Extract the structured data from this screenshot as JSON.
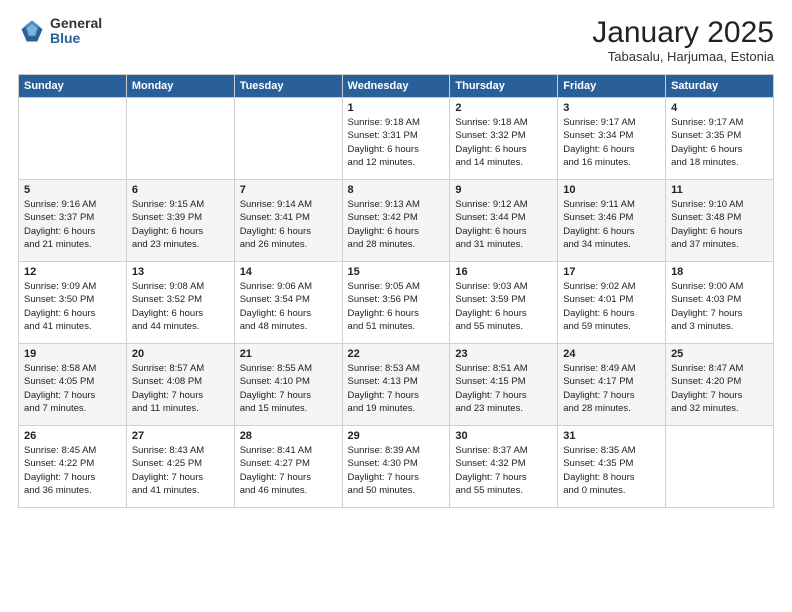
{
  "logo": {
    "general": "General",
    "blue": "Blue"
  },
  "header": {
    "title": "January 2025",
    "subtitle": "Tabasalu, Harjumaa, Estonia"
  },
  "weekdays": [
    "Sunday",
    "Monday",
    "Tuesday",
    "Wednesday",
    "Thursday",
    "Friday",
    "Saturday"
  ],
  "weeks": [
    [
      {
        "day": "",
        "info": ""
      },
      {
        "day": "",
        "info": ""
      },
      {
        "day": "",
        "info": ""
      },
      {
        "day": "1",
        "info": "Sunrise: 9:18 AM\nSunset: 3:31 PM\nDaylight: 6 hours\nand 12 minutes."
      },
      {
        "day": "2",
        "info": "Sunrise: 9:18 AM\nSunset: 3:32 PM\nDaylight: 6 hours\nand 14 minutes."
      },
      {
        "day": "3",
        "info": "Sunrise: 9:17 AM\nSunset: 3:34 PM\nDaylight: 6 hours\nand 16 minutes."
      },
      {
        "day": "4",
        "info": "Sunrise: 9:17 AM\nSunset: 3:35 PM\nDaylight: 6 hours\nand 18 minutes."
      }
    ],
    [
      {
        "day": "5",
        "info": "Sunrise: 9:16 AM\nSunset: 3:37 PM\nDaylight: 6 hours\nand 21 minutes."
      },
      {
        "day": "6",
        "info": "Sunrise: 9:15 AM\nSunset: 3:39 PM\nDaylight: 6 hours\nand 23 minutes."
      },
      {
        "day": "7",
        "info": "Sunrise: 9:14 AM\nSunset: 3:41 PM\nDaylight: 6 hours\nand 26 minutes."
      },
      {
        "day": "8",
        "info": "Sunrise: 9:13 AM\nSunset: 3:42 PM\nDaylight: 6 hours\nand 28 minutes."
      },
      {
        "day": "9",
        "info": "Sunrise: 9:12 AM\nSunset: 3:44 PM\nDaylight: 6 hours\nand 31 minutes."
      },
      {
        "day": "10",
        "info": "Sunrise: 9:11 AM\nSunset: 3:46 PM\nDaylight: 6 hours\nand 34 minutes."
      },
      {
        "day": "11",
        "info": "Sunrise: 9:10 AM\nSunset: 3:48 PM\nDaylight: 6 hours\nand 37 minutes."
      }
    ],
    [
      {
        "day": "12",
        "info": "Sunrise: 9:09 AM\nSunset: 3:50 PM\nDaylight: 6 hours\nand 41 minutes."
      },
      {
        "day": "13",
        "info": "Sunrise: 9:08 AM\nSunset: 3:52 PM\nDaylight: 6 hours\nand 44 minutes."
      },
      {
        "day": "14",
        "info": "Sunrise: 9:06 AM\nSunset: 3:54 PM\nDaylight: 6 hours\nand 48 minutes."
      },
      {
        "day": "15",
        "info": "Sunrise: 9:05 AM\nSunset: 3:56 PM\nDaylight: 6 hours\nand 51 minutes."
      },
      {
        "day": "16",
        "info": "Sunrise: 9:03 AM\nSunset: 3:59 PM\nDaylight: 6 hours\nand 55 minutes."
      },
      {
        "day": "17",
        "info": "Sunrise: 9:02 AM\nSunset: 4:01 PM\nDaylight: 6 hours\nand 59 minutes."
      },
      {
        "day": "18",
        "info": "Sunrise: 9:00 AM\nSunset: 4:03 PM\nDaylight: 7 hours\nand 3 minutes."
      }
    ],
    [
      {
        "day": "19",
        "info": "Sunrise: 8:58 AM\nSunset: 4:05 PM\nDaylight: 7 hours\nand 7 minutes."
      },
      {
        "day": "20",
        "info": "Sunrise: 8:57 AM\nSunset: 4:08 PM\nDaylight: 7 hours\nand 11 minutes."
      },
      {
        "day": "21",
        "info": "Sunrise: 8:55 AM\nSunset: 4:10 PM\nDaylight: 7 hours\nand 15 minutes."
      },
      {
        "day": "22",
        "info": "Sunrise: 8:53 AM\nSunset: 4:13 PM\nDaylight: 7 hours\nand 19 minutes."
      },
      {
        "day": "23",
        "info": "Sunrise: 8:51 AM\nSunset: 4:15 PM\nDaylight: 7 hours\nand 23 minutes."
      },
      {
        "day": "24",
        "info": "Sunrise: 8:49 AM\nSunset: 4:17 PM\nDaylight: 7 hours\nand 28 minutes."
      },
      {
        "day": "25",
        "info": "Sunrise: 8:47 AM\nSunset: 4:20 PM\nDaylight: 7 hours\nand 32 minutes."
      }
    ],
    [
      {
        "day": "26",
        "info": "Sunrise: 8:45 AM\nSunset: 4:22 PM\nDaylight: 7 hours\nand 36 minutes."
      },
      {
        "day": "27",
        "info": "Sunrise: 8:43 AM\nSunset: 4:25 PM\nDaylight: 7 hours\nand 41 minutes."
      },
      {
        "day": "28",
        "info": "Sunrise: 8:41 AM\nSunset: 4:27 PM\nDaylight: 7 hours\nand 46 minutes."
      },
      {
        "day": "29",
        "info": "Sunrise: 8:39 AM\nSunset: 4:30 PM\nDaylight: 7 hours\nand 50 minutes."
      },
      {
        "day": "30",
        "info": "Sunrise: 8:37 AM\nSunset: 4:32 PM\nDaylight: 7 hours\nand 55 minutes."
      },
      {
        "day": "31",
        "info": "Sunrise: 8:35 AM\nSunset: 4:35 PM\nDaylight: 8 hours\nand 0 minutes."
      },
      {
        "day": "",
        "info": ""
      }
    ]
  ]
}
